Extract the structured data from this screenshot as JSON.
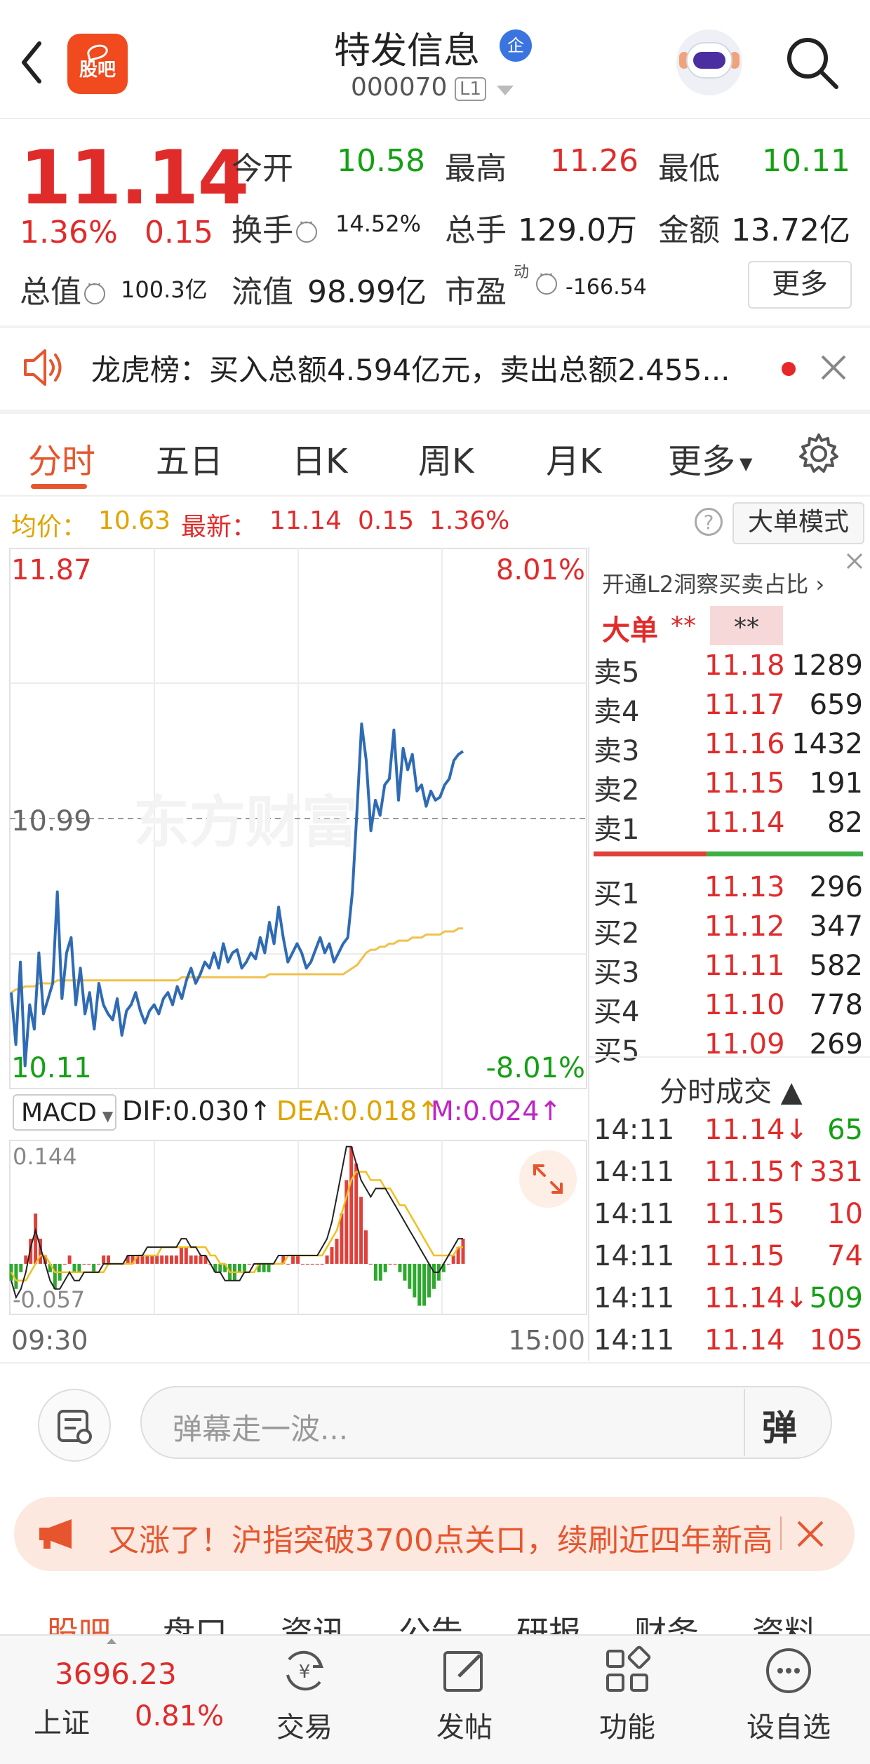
{
  "header": {
    "app_logo_text": "股吧",
    "stock_name": "特发信息",
    "enterprise_badge": "企",
    "stock_code": "000070",
    "level_badge": "L1"
  },
  "quote": {
    "price": "11.14",
    "change_pct": "1.36%",
    "change_amt": "0.15",
    "open_label": "今开",
    "open_val": "10.58",
    "high_label": "最高",
    "high_val": "11.26",
    "low_label": "最低",
    "low_val": "10.11",
    "turnover_label": "换手",
    "turnover_val": "14.52%",
    "volume_label": "总手",
    "volume_val": "129.0万",
    "amount_label": "金额",
    "amount_val": "13.72亿",
    "mktcap_label": "总值",
    "mktcap_val": "100.3亿",
    "float_label": "流值",
    "float_val": "98.99亿",
    "pe_label": "市盈",
    "pe_sup": "动",
    "pe_val": "-166.54",
    "more_label": "更多"
  },
  "notice": {
    "text": "龙虎榜：买入总额4.594亿元，卖出总额2.455..."
  },
  "chart_tabs": [
    "分时",
    "五日",
    "日K",
    "周K",
    "月K",
    "更多"
  ],
  "info_row": {
    "avg_label": "均价：",
    "avg_val": "10.63",
    "last_label": "最新：",
    "last_val": "11.14",
    "chg": "0.15",
    "pct": "1.36%",
    "help": "?",
    "big_order_mode": "大单模式"
  },
  "chart_data": {
    "type": "line",
    "ylim": [
      10.11,
      11.87
    ],
    "y_top_label": "11.87",
    "y_bottom_label": "10.11",
    "y_mid_label": "10.99",
    "pct_top_label": "8.01%",
    "pct_bottom_label": "-8.01%",
    "x_start_label": "09:30",
    "x_end_label": "15:00",
    "watermark": "东方财富",
    "price_series": [
      10.42,
      10.25,
      10.52,
      10.18,
      10.38,
      10.3,
      10.55,
      10.35,
      10.4,
      10.45,
      10.75,
      10.4,
      10.55,
      10.6,
      10.38,
      10.5,
      10.35,
      10.42,
      10.3,
      10.45,
      10.38,
      10.35,
      10.33,
      10.4,
      10.28,
      10.36,
      10.38,
      10.42,
      10.36,
      10.32,
      10.36,
      10.38,
      10.35,
      10.4,
      10.42,
      10.38,
      10.44,
      10.4,
      10.46,
      10.5,
      10.45,
      10.48,
      10.52,
      10.5,
      10.55,
      10.5,
      10.58,
      10.52,
      10.55,
      10.56,
      10.5,
      10.52,
      10.55,
      10.53,
      10.6,
      10.55,
      10.65,
      10.58,
      10.7,
      10.6,
      10.52,
      10.55,
      10.58,
      10.55,
      10.5,
      10.52,
      10.56,
      10.6,
      10.55,
      10.58,
      10.52,
      10.55,
      10.58,
      10.6,
      10.75,
      11.02,
      11.3,
      11.18,
      10.95,
      11.05,
      11.0,
      11.1,
      11.12,
      11.28,
      11.05,
      11.22,
      11.15,
      11.2,
      11.08,
      11.1,
      11.03,
      11.08,
      11.05,
      11.06,
      11.1,
      11.12,
      11.18,
      11.2,
      11.21
    ],
    "avg_series": [
      10.42,
      10.43,
      10.43,
      10.44,
      10.44,
      10.44,
      10.45,
      10.45,
      10.45,
      10.45,
      10.46,
      10.46,
      10.46,
      10.46,
      10.46,
      10.46,
      10.46,
      10.46,
      10.46,
      10.46,
      10.46,
      10.46,
      10.46,
      10.46,
      10.46,
      10.46,
      10.46,
      10.46,
      10.46,
      10.46,
      10.46,
      10.46,
      10.46,
      10.46,
      10.46,
      10.46,
      10.46,
      10.47,
      10.47,
      10.47,
      10.47,
      10.47,
      10.47,
      10.47,
      10.47,
      10.47,
      10.47,
      10.47,
      10.47,
      10.47,
      10.47,
      10.47,
      10.47,
      10.47,
      10.47,
      10.47,
      10.48,
      10.48,
      10.48,
      10.48,
      10.48,
      10.48,
      10.48,
      10.48,
      10.48,
      10.48,
      10.48,
      10.48,
      10.48,
      10.48,
      10.48,
      10.48,
      10.48,
      10.49,
      10.5,
      10.51,
      10.53,
      10.55,
      10.56,
      10.56,
      10.57,
      10.57,
      10.58,
      10.58,
      10.59,
      10.59,
      10.59,
      10.6,
      10.6,
      10.6,
      10.61,
      10.61,
      10.61,
      10.61,
      10.62,
      10.62,
      10.62,
      10.63,
      10.63
    ],
    "macd": {
      "select_label": "MACD",
      "dif_label": "DIF:0.030↑",
      "dea_label": "DEA:0.018↑",
      "m_label": "M:0.024↑",
      "top_label": "0.144",
      "bottom_label": "-0.057",
      "ylim": [
        -0.057,
        0.144
      ],
      "hist": [
        -0.02,
        -0.03,
        -0.01,
        0.01,
        0.03,
        0.06,
        0.03,
        0.01,
        -0.01,
        -0.03,
        -0.02,
        0.0,
        0.01,
        -0.01,
        -0.01,
        0.0,
        0.0,
        -0.01,
        0.0,
        0.01,
        0.01,
        0.0,
        0.0,
        0.0,
        0.01,
        0.01,
        0.01,
        0.01,
        0.01,
        0.01,
        0.01,
        0.01,
        0.01,
        0.01,
        0.01,
        0.02,
        0.02,
        0.01,
        0.01,
        0.01,
        0.01,
        0.0,
        -0.01,
        -0.01,
        -0.01,
        -0.02,
        -0.02,
        -0.01,
        -0.01,
        0.0,
        0.0,
        -0.01,
        -0.01,
        -0.01,
        0.0,
        0.0,
        0.01,
        0.0,
        0.01,
        0.01,
        0.0,
        0.0,
        0.0,
        0.0,
        0.0,
        0.01,
        0.02,
        0.03,
        0.06,
        0.1,
        0.14,
        0.12,
        0.08,
        0.04,
        0.0,
        -0.02,
        -0.02,
        -0.01,
        0.0,
        0.0,
        -0.01,
        -0.02,
        -0.03,
        -0.04,
        -0.05,
        -0.05,
        -0.04,
        -0.03,
        -0.02,
        -0.01,
        0.0,
        0.01,
        0.02,
        0.03
      ],
      "dif": [
        -0.02,
        -0.04,
        -0.03,
        -0.01,
        0.02,
        0.04,
        0.02,
        0.0,
        -0.02,
        -0.03,
        -0.03,
        -0.02,
        -0.01,
        -0.02,
        -0.02,
        -0.01,
        -0.01,
        -0.01,
        -0.01,
        0.0,
        0.0,
        0.0,
        0.0,
        0.0,
        0.01,
        0.01,
        0.01,
        0.01,
        0.02,
        0.02,
        0.02,
        0.02,
        0.02,
        0.02,
        0.02,
        0.03,
        0.03,
        0.02,
        0.02,
        0.01,
        0.01,
        0.0,
        -0.01,
        -0.01,
        -0.02,
        -0.02,
        -0.02,
        -0.02,
        -0.01,
        -0.01,
        0.0,
        0.0,
        0.0,
        0.0,
        0.0,
        0.01,
        0.01,
        0.01,
        0.01,
        0.01,
        0.01,
        0.01,
        0.01,
        0.01,
        0.02,
        0.03,
        0.05,
        0.08,
        0.11,
        0.14,
        0.14,
        0.12,
        0.1,
        0.09,
        0.08,
        0.09,
        0.09,
        0.09,
        0.08,
        0.07,
        0.06,
        0.05,
        0.04,
        0.03,
        0.02,
        0.01,
        0.0,
        -0.01,
        -0.01,
        0.0,
        0.01,
        0.02,
        0.03,
        0.03
      ],
      "dea": [
        -0.01,
        -0.02,
        -0.02,
        -0.02,
        -0.01,
        0.0,
        0.01,
        0.01,
        0.0,
        -0.01,
        -0.01,
        -0.01,
        -0.01,
        -0.01,
        -0.01,
        -0.01,
        -0.01,
        -0.01,
        -0.01,
        -0.01,
        0.0,
        0.0,
        0.0,
        0.0,
        0.0,
        0.0,
        0.01,
        0.01,
        0.01,
        0.01,
        0.01,
        0.02,
        0.02,
        0.02,
        0.02,
        0.02,
        0.02,
        0.02,
        0.02,
        0.02,
        0.02,
        0.01,
        0.01,
        0.0,
        0.0,
        -0.01,
        -0.01,
        -0.01,
        -0.01,
        -0.01,
        -0.01,
        0.0,
        0.0,
        0.0,
        0.0,
        0.0,
        0.0,
        0.01,
        0.01,
        0.01,
        0.01,
        0.01,
        0.01,
        0.01,
        0.01,
        0.02,
        0.03,
        0.04,
        0.06,
        0.08,
        0.1,
        0.11,
        0.11,
        0.11,
        0.1,
        0.1,
        0.1,
        0.09,
        0.09,
        0.08,
        0.07,
        0.07,
        0.06,
        0.05,
        0.04,
        0.03,
        0.02,
        0.01,
        0.01,
        0.01,
        0.01,
        0.01,
        0.02,
        0.02
      ]
    }
  },
  "order_book": {
    "promo": "开通L2洞察买卖占比 ›",
    "dadan_label": "大单",
    "dadan_stars": "**",
    "dadan_box": "**",
    "sells": [
      {
        "label": "卖5",
        "price": "11.18",
        "vol": "1289"
      },
      {
        "label": "卖4",
        "price": "11.17",
        "vol": "659"
      },
      {
        "label": "卖3",
        "price": "11.16",
        "vol": "1432"
      },
      {
        "label": "卖2",
        "price": "11.15",
        "vol": "191"
      },
      {
        "label": "卖1",
        "price": "11.14",
        "vol": "82"
      }
    ],
    "buys": [
      {
        "label": "买1",
        "price": "11.13",
        "vol": "296"
      },
      {
        "label": "买2",
        "price": "11.12",
        "vol": "347"
      },
      {
        "label": "买3",
        "price": "11.11",
        "vol": "582"
      },
      {
        "label": "买4",
        "price": "11.10",
        "vol": "778"
      },
      {
        "label": "买5",
        "price": "11.09",
        "vol": "269"
      }
    ],
    "sell_ratio": 0.42,
    "sell_color": "#e0403a",
    "buy_color": "#3cb043"
  },
  "trades": {
    "title": "分时成交 ▲",
    "rows": [
      {
        "time": "14:11",
        "price": "11.14↓",
        "vol": "65",
        "dir": "down"
      },
      {
        "time": "14:11",
        "price": "11.15↑",
        "vol": "331",
        "dir": "up"
      },
      {
        "time": "14:11",
        "price": "11.15",
        "vol": "10",
        "dir": "up"
      },
      {
        "time": "14:11",
        "price": "11.15",
        "vol": "74",
        "dir": "up"
      },
      {
        "time": "14:11",
        "price": "11.14↓",
        "vol": "509",
        "dir": "down"
      },
      {
        "time": "14:11",
        "price": "11.14",
        "vol": "105",
        "dir": "up"
      }
    ]
  },
  "comment": {
    "placeholder": "弹幕走一波...",
    "danmu_btn": "弹"
  },
  "banner": {
    "text": "又涨了！沪指突破3700点关口，续刷近四年新高"
  },
  "lower_tabs": [
    "股吧",
    "盘口",
    "资讯",
    "公告",
    "研报",
    "财务",
    "资料"
  ],
  "bottom_nav": {
    "index_val": "3696.23",
    "index_name": "上证",
    "index_pct": "0.81%",
    "items": [
      "交易",
      "发帖",
      "功能",
      "设自选"
    ]
  },
  "colors": {
    "up": "#e02b2b",
    "down": "#14a014",
    "accent": "#e6552e",
    "price_line": "#2f6bb5",
    "avg_line": "#f0c14b"
  }
}
